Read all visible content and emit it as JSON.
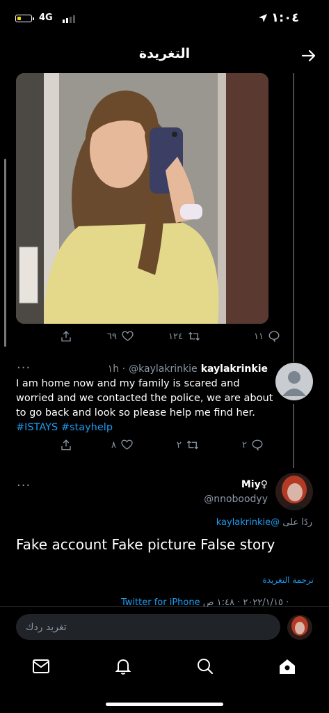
{
  "status_bar": {
    "network": "4G",
    "time": "١:٠٤"
  },
  "header": {
    "title": "التغريدة",
    "back_icon": "arrow-right-icon"
  },
  "photo_tweet_actions": {
    "reply_count": "١١",
    "retweet_count": "١٢٤",
    "like_count": "٦٩"
  },
  "tweet": {
    "name": "kaylakrinkie",
    "handle": "@kaylakrinkie",
    "time": "١h ·",
    "text": "I am home now and my family is scared and worried and we contacted the police, we are about to go back and look so please help me find her.",
    "hashtags": [
      "#ISTAYS",
      "#stayhelp"
    ],
    "reply_count": "٢",
    "retweet_count": "٢",
    "like_count": "٨"
  },
  "reply": {
    "name": "Miy♀",
    "handle": "@nnoboodyy",
    "replying_to_label": "ردًا على",
    "replying_to_handle": "@kaylakrinkie",
    "text": "Fake account Fake picture False story",
    "translate": "ترجمة التغريدة",
    "date": "٢٠٢٢/١/١٥ · ١:٤٨ ص ·",
    "source": "Twitter for iPhone"
  },
  "composer": {
    "placeholder": "تغريد ردك"
  },
  "tabs": [
    "mail-icon",
    "bell-icon",
    "search-icon",
    "home-icon"
  ],
  "colors": {
    "accent": "#1d9bf0",
    "background": "#000000",
    "secondary_text": "#8b98a5"
  }
}
